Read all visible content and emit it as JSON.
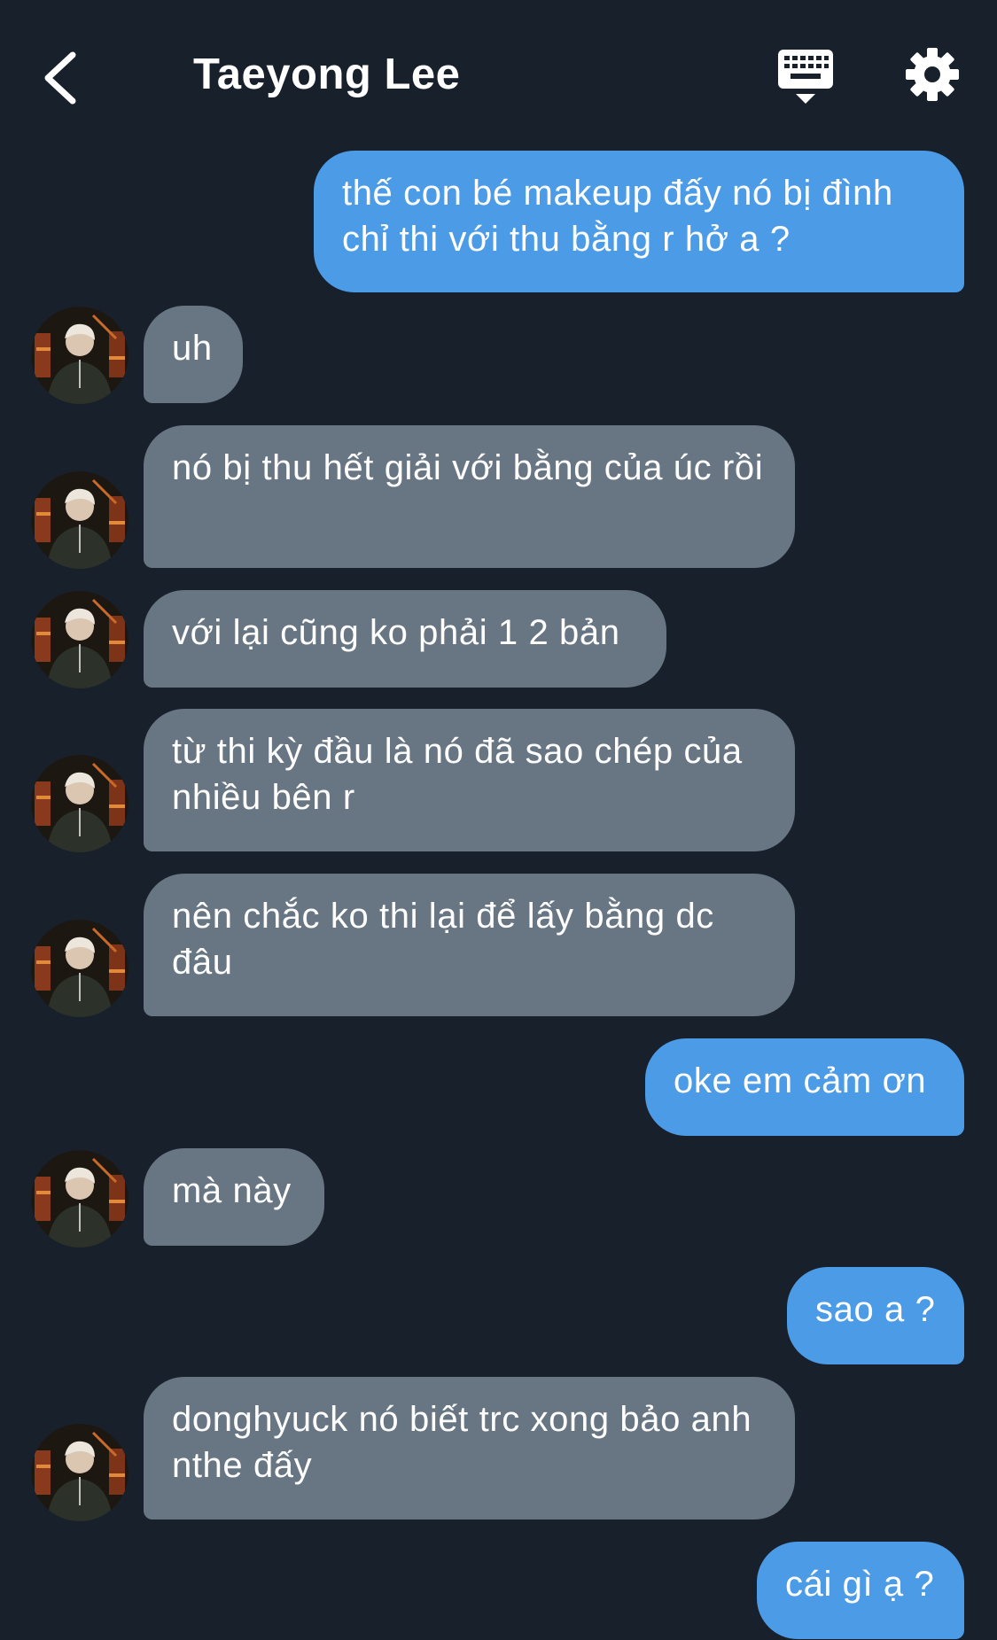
{
  "header": {
    "title": "Taeyong Lee",
    "back_icon": "chevron-left-icon",
    "keyboard_icon": "keyboard-icon",
    "settings_icon": "gear-icon"
  },
  "colors": {
    "background": "#18202b",
    "outgoing_bubble": "#4c9be6",
    "incoming_bubble": "#687684",
    "text": "#ffffff"
  },
  "messages": [
    {
      "dir": "out",
      "text": "thế con bé makeup đấy nó bị đình chỉ thi với thu bằng r hở a ?"
    },
    {
      "dir": "in",
      "text": "uh"
    },
    {
      "dir": "in",
      "text": "nó bị thu hết giải với bằng của úc rồi"
    },
    {
      "dir": "in",
      "text": "với lại cũng ko phải 1 2 bản"
    },
    {
      "dir": "in",
      "text": "từ thi kỳ đầu là nó đã sao chép của nhiều bên r"
    },
    {
      "dir": "in",
      "text": "nên chắc ko thi lại để lấy bằng dc đâu"
    },
    {
      "dir": "out",
      "text": "oke em cảm ơn"
    },
    {
      "dir": "in",
      "text": "mà này"
    },
    {
      "dir": "out",
      "text": "sao a ?"
    },
    {
      "dir": "in",
      "text": "donghyuck nó biết trc xong bảo anh nthe đấy"
    },
    {
      "dir": "out",
      "text": "cái gì ạ ?"
    }
  ]
}
